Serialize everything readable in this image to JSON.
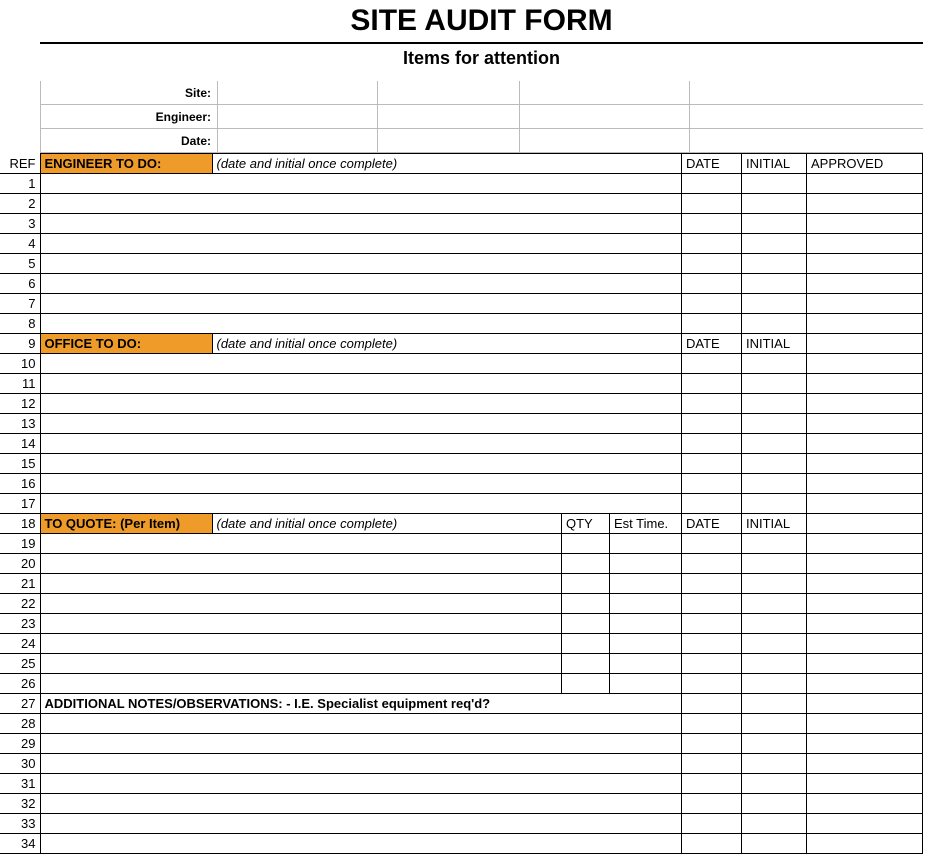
{
  "title": "SITE AUDIT FORM",
  "subtitle": "Items for attention",
  "header": {
    "site_label": "Site:",
    "engineer_label": "Engineer:",
    "date_label": "Date:"
  },
  "ref_label": "REF",
  "sections": {
    "engineer": {
      "label": "ENGINEER TO DO:",
      "note": "(date and initial once complete)",
      "col_date": "DATE",
      "col_initial": "INITIAL",
      "col_approved": "APPROVED",
      "rows": [
        "1",
        "2",
        "3",
        "4",
        "5",
        "6",
        "7",
        "8"
      ]
    },
    "office": {
      "ref": "9",
      "label": "OFFICE TO DO:",
      "note": "(date and initial once complete)",
      "col_date": "DATE",
      "col_initial": "INITIAL",
      "rows": [
        "10",
        "11",
        "12",
        "13",
        "14",
        "15",
        "16",
        "17"
      ]
    },
    "quote": {
      "ref": "18",
      "label": "TO QUOTE: (Per Item)",
      "note": "(date and initial once complete)",
      "col_qty": "QTY",
      "col_est": "Est Time.",
      "col_date": "DATE",
      "col_initial": "INITIAL",
      "rows": [
        "19",
        "20",
        "21",
        "22",
        "23",
        "24",
        "25",
        "26"
      ]
    },
    "notes": {
      "ref": "27",
      "label": "ADDITIONAL NOTES/OBSERVATIONS: - I.E. Specialist equipment req'd?",
      "rows": [
        "28",
        "29",
        "30",
        "31",
        "32",
        "33",
        "34"
      ]
    }
  }
}
